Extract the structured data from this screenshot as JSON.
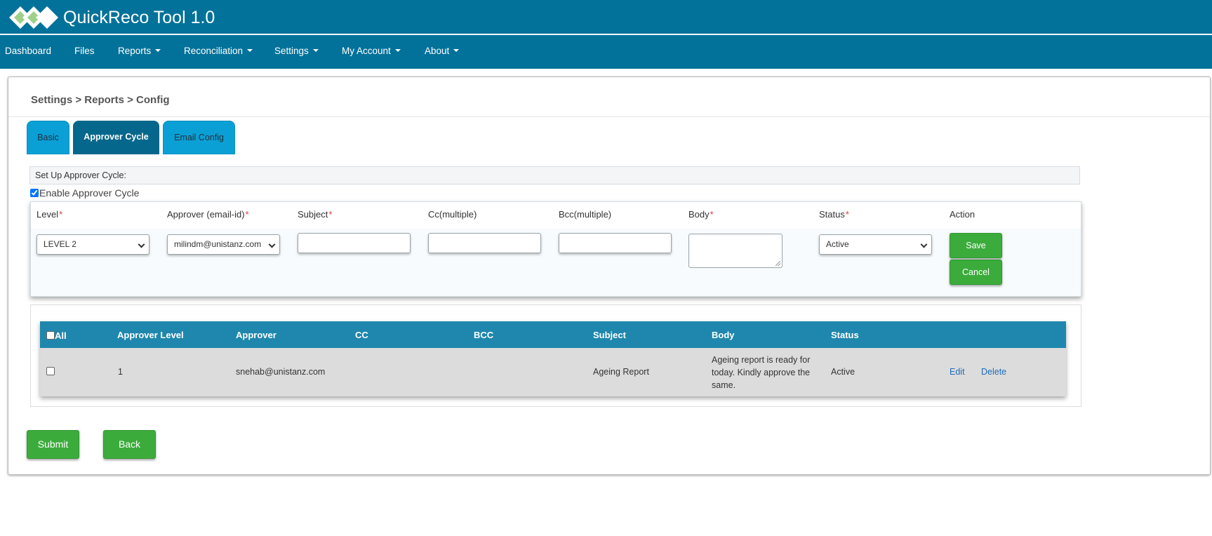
{
  "header": {
    "app_title": "QuickReco Tool 1.0",
    "nav": [
      {
        "label": "Dashboard",
        "dropdown": false
      },
      {
        "label": "Files",
        "dropdown": false
      },
      {
        "label": "Reports",
        "dropdown": true
      },
      {
        "label": "Reconciliation",
        "dropdown": true
      },
      {
        "label": "Settings",
        "dropdown": true
      },
      {
        "label": "My Account",
        "dropdown": true
      },
      {
        "label": "About",
        "dropdown": true
      }
    ]
  },
  "breadcrumb": "Settings > Reports > Config",
  "tabs": [
    {
      "label": "Basic",
      "active": false
    },
    {
      "label": "Approver Cycle",
      "active": true
    },
    {
      "label": "Email Config",
      "active": false
    }
  ],
  "section_title": "Set Up Approver Cycle:",
  "enable_approver_cycle": {
    "label": "Enable Approver Cycle",
    "checked": true
  },
  "form": {
    "labels": {
      "level": "Level",
      "approver": "Approver (email-id)",
      "subject": "Subject",
      "cc": "Cc(multiple)",
      "bcc": "Bcc(multiple)",
      "body": "Body",
      "status": "Status",
      "action": "Action"
    },
    "required_mark": "*",
    "values": {
      "level": "LEVEL 2",
      "approver": "milindm@unistanz.com",
      "subject": "",
      "cc": "",
      "bcc": "",
      "body": "",
      "status": "Active"
    },
    "save_label": "Save",
    "cancel_label": "Cancel"
  },
  "table": {
    "select_all_label": "All",
    "columns": [
      "Approver Level",
      "Approver",
      "CC",
      "BCC",
      "Subject",
      "Body",
      "Status"
    ],
    "rows": [
      {
        "level": "1",
        "approver": "snehab@unistanz.com",
        "cc": "",
        "bcc": "",
        "subject": "Ageing Report",
        "body": "Ageing report is ready for today. Kindly approve the same.",
        "status": "Active",
        "edit_label": "Edit",
        "delete_label": "Delete"
      }
    ]
  },
  "footer": {
    "submit_label": "Submit",
    "back_label": "Back"
  },
  "colors": {
    "brand": "#02729a",
    "tab_active": "#05678b",
    "tab_inactive": "#0aa0d6",
    "table_header": "#1f87ad",
    "button_green": "#3bab3b",
    "required": "#e03a3a",
    "link": "#1d6bb8"
  }
}
